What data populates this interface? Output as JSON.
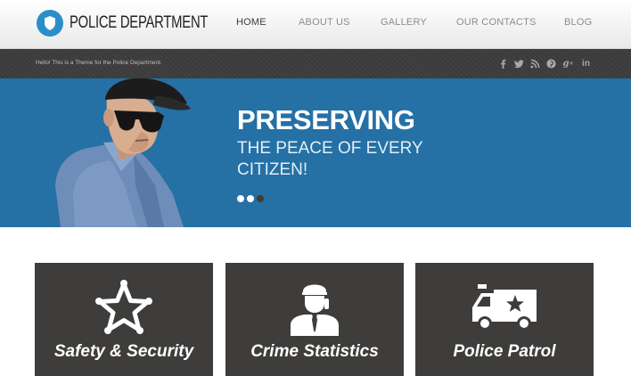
{
  "header": {
    "logo_text": "POLICE DEPARTMENT",
    "nav": [
      {
        "label": "HOME",
        "active": true
      },
      {
        "label": "ABOUT US",
        "active": false
      },
      {
        "label": "GALLERY",
        "active": false
      },
      {
        "label": "OUR CONTACTS",
        "active": false
      },
      {
        "label": "BLOG",
        "active": false
      }
    ]
  },
  "infobar": {
    "tagline": "Hello! This is a Theme for the Police Department.",
    "socials": [
      "facebook-icon",
      "twitter-icon",
      "rss-icon",
      "pinterest-icon",
      "google-plus-icon",
      "linkedin-icon"
    ]
  },
  "hero": {
    "title": "PRESERVING",
    "subtitle": "THE PEACE OF EVERY CITIZEN!",
    "slides": 3,
    "active_slide": 3
  },
  "features": [
    {
      "label": "Safety & Security",
      "icon": "sheriff-star-icon"
    },
    {
      "label": "Crime Statistics",
      "icon": "officer-phone-icon"
    },
    {
      "label": "Police Patrol",
      "icon": "patrol-van-icon"
    }
  ],
  "colors": {
    "brand_blue": "#2570a5",
    "dark_bar": "#3d3d3d",
    "feature_box": "#3e3d3b",
    "logo_badge": "#2a8fc8"
  }
}
